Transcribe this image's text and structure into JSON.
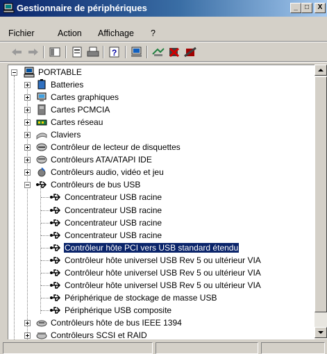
{
  "window": {
    "title": "Gestionnaire de périphériques",
    "icon": "device-manager-icon",
    "controls": {
      "minimize": "_",
      "maximize": "□",
      "close": "X"
    }
  },
  "menu": {
    "items": [
      "Fichier",
      "Action",
      "Affichage",
      "?"
    ]
  },
  "toolbar": {
    "buttons": [
      "back-arrow-icon",
      "forward-arrow-icon",
      "console-tree-icon",
      "properties-icon",
      "print-icon",
      "help-icon",
      "scan-hardware-icon",
      "update-driver-icon",
      "uninstall-icon",
      "disable-icon"
    ]
  },
  "tree": {
    "root": "PORTABLE",
    "categories": [
      "Batteries",
      "Cartes graphiques",
      "Cartes PCMCIA",
      "Cartes réseau",
      "Claviers",
      "Contrôleur de lecteur de disquettes",
      "Contrôleurs ATA/ATAPI IDE",
      "Contrôleurs audio, vidéo et jeu",
      "Contrôleurs de bus USB"
    ],
    "usb_children": [
      "Concentrateur USB racine",
      "Concentrateur USB racine",
      "Concentrateur USB racine",
      "Concentrateur USB racine",
      "Contrôleur hôte PCI vers USB standard étendu",
      "Contrôleur hôte universel USB Rev 5 ou  ultérieur VIA",
      "Contrôleur hôte universel USB Rev 5 ou  ultérieur VIA",
      "Contrôleur hôte universel USB Rev 5 ou  ultérieur VIA",
      "Périphérique de stockage de masse USB",
      "Périphérique USB composite"
    ],
    "after": [
      "Contrôleurs hôte de bus IEEE 1394",
      "Contrôleurs SCSI et RAID"
    ],
    "selected": "Contrôleur hôte PCI vers USB standard étendu"
  },
  "colors": {
    "selection": "#0a246a",
    "titlebar": "#0a246a",
    "face": "#d4d0c8"
  }
}
